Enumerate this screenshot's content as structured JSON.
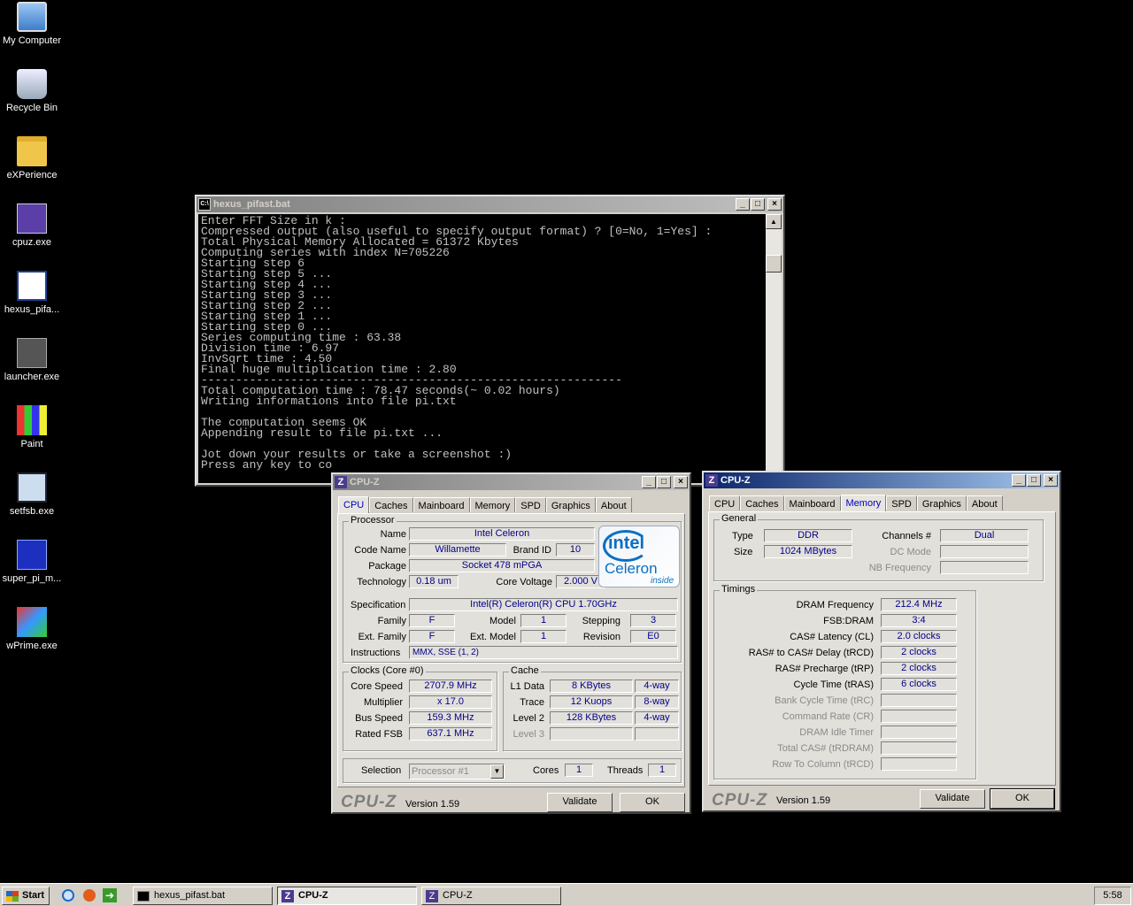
{
  "desktop": {
    "icons": [
      {
        "label": "My Computer",
        "icon": "computer-icon"
      },
      {
        "label": "Recycle Bin",
        "icon": "recycle-bin-icon"
      },
      {
        "label": "eXPerience",
        "icon": "folder-icon"
      },
      {
        "label": "cpuz.exe",
        "icon": "cpuz-icon"
      },
      {
        "label": "hexus_pifa...",
        "icon": "batch-file-icon"
      },
      {
        "label": "launcher.exe",
        "icon": "launcher-icon"
      },
      {
        "label": "Paint",
        "icon": "paint-icon"
      },
      {
        "label": "setfsb.exe",
        "icon": "pll-icon"
      },
      {
        "label": "super_pi_m...",
        "icon": "superpi-icon"
      },
      {
        "label": "wPrime.exe",
        "icon": "wprime-icon"
      }
    ]
  },
  "console": {
    "title": "hexus_pifast.bat",
    "lines": [
      "Enter FFT Size in k :",
      "Compressed output (also useful to specify output format) ? [0=No, 1=Yes] :",
      "Total Physical Memory Allocated = 61372 Kbytes",
      "Computing series with index N=705226",
      "Starting step 6",
      "Starting step 5 ...",
      "Starting step 4 ...",
      "Starting step 3 ...",
      "Starting step 2 ...",
      "Starting step 1 ...",
      "Starting step 0 ...",
      "Series computing time : 63.38",
      "Division time : 6.97",
      "InvSqrt time : 4.50",
      "Final huge multiplication time : 2.80",
      "-------------------------------------------------------------",
      "Total computation time : 78.47 seconds(~ 0.02 hours)",
      "Writing informations into file pi.txt",
      "",
      "The computation seems OK",
      "Appending result to file pi.txt ...",
      "",
      "Jot down your results or take a screenshot :)",
      "Press any key to co"
    ]
  },
  "cpuz_tabs": [
    "CPU",
    "Caches",
    "Mainboard",
    "Memory",
    "SPD",
    "Graphics",
    "About"
  ],
  "cpuz1": {
    "title": "CPU-Z",
    "processor_group": "Processor",
    "name_label": "Name",
    "name": "Intel Celeron",
    "codename_label": "Code Name",
    "codename": "Willamette",
    "brandid_label": "Brand ID",
    "brandid": "10",
    "package_label": "Package",
    "package": "Socket 478 mPGA",
    "tech_label": "Technology",
    "tech": "0.18 um",
    "voltage_label": "Core Voltage",
    "voltage": "2.000 V",
    "spec_label": "Specification",
    "spec": "Intel(R) Celeron(R) CPU 1.70GHz",
    "family_label": "Family",
    "family": "F",
    "model_label": "Model",
    "model": "1",
    "stepping_label": "Stepping",
    "stepping": "3",
    "extfamily_label": "Ext. Family",
    "extfamily": "F",
    "extmodel_label": "Ext. Model",
    "extmodel": "1",
    "revision_label": "Revision",
    "revision": "E0",
    "instr_label": "Instructions",
    "instr": "MMX, SSE (1, 2)",
    "clocks_group": "Clocks (Core #0)",
    "corespeed_label": "Core Speed",
    "corespeed": "2707.9 MHz",
    "multiplier_label": "Multiplier",
    "multiplier": "x 17.0",
    "busspeed_label": "Bus Speed",
    "busspeed": "159.3 MHz",
    "ratedfsb_label": "Rated FSB",
    "ratedfsb": "637.1 MHz",
    "cache_group": "Cache",
    "l1_label": "L1 Data",
    "l1": "8 KBytes",
    "l1way": "4-way",
    "trace_label": "Trace",
    "trace": "12 Kuops",
    "traceway": "8-way",
    "l2_label": "Level 2",
    "l2": "128 KBytes",
    "l2way": "4-way",
    "l3_label": "Level 3",
    "selection_label": "Selection",
    "selection": "Processor #1",
    "cores_label": "Cores",
    "cores": "1",
    "threads_label": "Threads",
    "threads": "1",
    "brand": "CPU-Z",
    "version": "Version 1.59",
    "validate": "Validate",
    "ok": "OK",
    "logo_intel": "intel",
    "logo_celeron": "Celeron",
    "logo_inside": "inside"
  },
  "cpuz2": {
    "title": "CPU-Z",
    "general_group": "General",
    "type_label": "Type",
    "type": "DDR",
    "channels_label": "Channels #",
    "channels": "Dual",
    "size_label": "Size",
    "size": "1024 MBytes",
    "dcmode_label": "DC Mode",
    "nbfreq_label": "NB Frequency",
    "timings_group": "Timings",
    "dramfreq_label": "DRAM Frequency",
    "dramfreq": "212.4 MHz",
    "fsbdram_label": "FSB:DRAM",
    "fsbdram": "3:4",
    "cl_label": "CAS# Latency (CL)",
    "cl": "2.0 clocks",
    "trcd_label": "RAS# to CAS# Delay (tRCD)",
    "trcd": "2 clocks",
    "trp_label": "RAS# Precharge (tRP)",
    "trp": "2 clocks",
    "tras_label": "Cycle Time (tRAS)",
    "tras": "6 clocks",
    "trc_label": "Bank Cycle Time (tRC)",
    "cr_label": "Command Rate (CR)",
    "idle_label": "DRAM Idle Timer",
    "trdram_label": "Total CAS# (tRDRAM)",
    "rtc_label": "Row To Column (tRCD)",
    "brand": "CPU-Z",
    "version": "Version 1.59",
    "validate": "Validate",
    "ok": "OK"
  },
  "taskbar": {
    "start": "Start",
    "tasks": [
      "hexus_pifast.bat",
      "CPU-Z",
      "CPU-Z"
    ],
    "clock": "5:58"
  }
}
